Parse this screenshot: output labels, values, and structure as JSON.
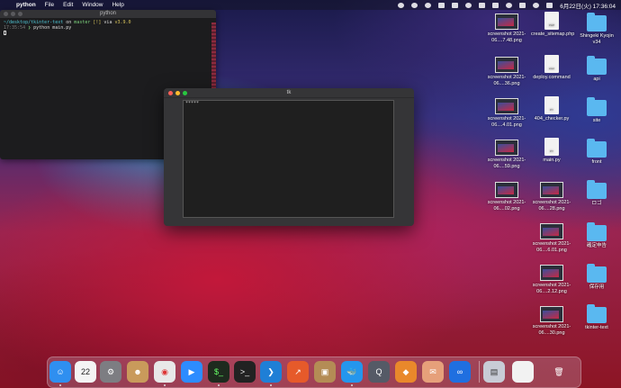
{
  "menubar": {
    "apple_glyph": "",
    "app_name": "python",
    "items": [
      "File",
      "Edit",
      "Window",
      "Help"
    ],
    "clock": "6月22日(火)  17:36:04"
  },
  "terminal": {
    "title": "python",
    "line1_path": "~/desktop/tkinter-text",
    "line1_on": "on",
    "line1_branch": "master",
    "line1_status": "[!]",
    "line1_via": "via",
    "line1_version": "v3.9.0",
    "line2_time": "17:35:54",
    "line2_prompt": "❯",
    "line2_cmd": "python main.py"
  },
  "tk_window": {
    "title": "tk",
    "canvas_text": "*****"
  },
  "desktop_icons": [
    {
      "kind": "thumb",
      "label": "screenshot 2021-06....7.48.png"
    },
    {
      "kind": "doc",
      "label": "create_sitemap.php",
      "doc_tag": "PHP"
    },
    {
      "kind": "folder",
      "label": "Shingeki Kyojin v34"
    },
    {
      "kind": "thumb",
      "label": "screenshot 2021-06....36.png"
    },
    {
      "kind": "doc",
      "label": "deploy.command",
      "doc_tag": "exec"
    },
    {
      "kind": "folder",
      "label": "api"
    },
    {
      "kind": "thumb",
      "label": "screenshot 2021-06....4.01.png"
    },
    {
      "kind": "doc",
      "label": "404_checker.py",
      "doc_tag": "PY"
    },
    {
      "kind": "folder",
      "label": "site"
    },
    {
      "kind": "thumb",
      "label": "screenshot 2021-06....59.png"
    },
    {
      "kind": "doc",
      "label": "main.py",
      "doc_tag": "PY"
    },
    {
      "kind": "folder",
      "label": "front"
    },
    {
      "kind": "thumb",
      "label": "screenshot 2021-06....02.png"
    },
    {
      "kind": "thumb",
      "label": "screenshot 2021-06....28.png"
    },
    {
      "kind": "folder",
      "label": "ロゴ"
    },
    {
      "kind": "thumb",
      "label": "screenshot 2021-06....6.01.png"
    },
    {
      "kind": "folder",
      "label": "確定申告"
    },
    {
      "kind": "thumb",
      "label": "screenshot 2021-06....2.12.png"
    },
    {
      "kind": "folder",
      "label": "保存用"
    },
    {
      "kind": "thumb",
      "label": "screenshot 2021-06....30.png"
    },
    {
      "kind": "folder",
      "label": "tkinter-text"
    }
  ],
  "dock": {
    "apps": [
      {
        "name": "finder-icon",
        "glyph": "☺",
        "color": "#2f8ff0"
      },
      {
        "name": "calendar-icon",
        "glyph": "22",
        "color": "#f4f4f4",
        "text_color": "#222"
      },
      {
        "name": "system-preferences-icon",
        "glyph": "⚙",
        "color": "#7d7d82"
      },
      {
        "name": "contacts-icon",
        "glyph": "☻",
        "color": "#c99a5b"
      },
      {
        "name": "chrome-icon",
        "glyph": "◉",
        "color": "#e8e8e8",
        "text_color": "#d33"
      },
      {
        "name": "zoom-icon",
        "glyph": "▶",
        "color": "#2d8cff"
      },
      {
        "name": "iterm-icon",
        "glyph": "$_",
        "color": "#1e2a1e",
        "text_color": "#6f6"
      },
      {
        "name": "terminal-icon",
        "glyph": ">_",
        "color": "#222",
        "text_color": "#eee"
      },
      {
        "name": "vscode-icon",
        "glyph": "❯",
        "color": "#1f7fd6"
      },
      {
        "name": "chart-app-icon",
        "glyph": "↗",
        "color": "#e65a2a"
      },
      {
        "name": "archive-utility-icon",
        "glyph": "▣",
        "color": "#b48c55"
      },
      {
        "name": "docker-icon",
        "glyph": "🐳",
        "color": "#2496ed"
      },
      {
        "name": "quicktime-icon",
        "glyph": "Q",
        "color": "#555a66"
      },
      {
        "name": "sourcetree-icon",
        "glyph": "◆",
        "color": "#e9882b"
      },
      {
        "name": "mail-app-icon",
        "glyph": "✉",
        "color": "#e6a07a"
      },
      {
        "name": "infinity-app-icon",
        "glyph": "∞",
        "color": "#1f6fe0"
      },
      {
        "name": "preview-icon",
        "glyph": "▤",
        "color": "#c8ccd6",
        "text_color": "#333"
      },
      {
        "name": "document-icon",
        "glyph": "",
        "color": "#f2f2f2"
      },
      {
        "name": "trash-icon",
        "glyph": "🗑",
        "color": "rgba(0,0,0,0)"
      }
    ]
  },
  "colors": {
    "close": "#ff5f57",
    "minimize": "#febc2e",
    "maximize": "#28c840"
  }
}
